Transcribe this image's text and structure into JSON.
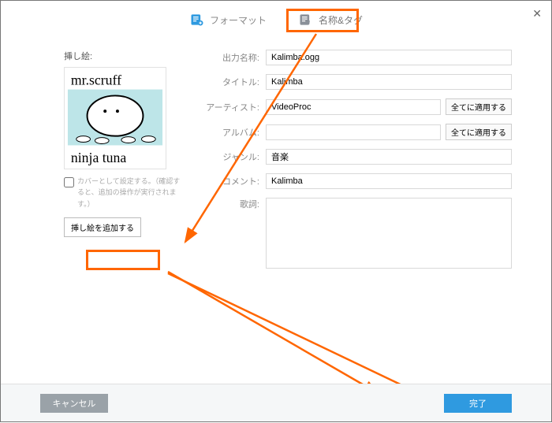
{
  "tabs": {
    "format": "フォーマット",
    "nameTags": "名称&タグ"
  },
  "close": "✕",
  "artwork": {
    "label": "挿し絵:",
    "title_top": "mr.scruff",
    "title_bottom": "ninja tuna",
    "coverOption": "カバーとして設定する。（確認すると、追加の操作が実行されます。）",
    "addButton": "挿し絵を追加する"
  },
  "fields": {
    "outputName": {
      "label": "出力名称:",
      "value": "Kalimba.ogg"
    },
    "title": {
      "label": "タイトル:",
      "value": "Kalimba"
    },
    "artist": {
      "label": "アーティスト:",
      "value": "VideoProc"
    },
    "album": {
      "label": "アルバム:",
      "value": ""
    },
    "genre": {
      "label": "ジャンル:",
      "value": "音楽"
    },
    "comment": {
      "label": "コメント:",
      "value": "Kalimba"
    },
    "lyrics": {
      "label": "歌詞:",
      "value": ""
    }
  },
  "applyAll": "全てに適用する",
  "footer": {
    "cancel": "キャンセル",
    "done": "完了"
  },
  "annotations": {
    "color": "#ff6600"
  }
}
